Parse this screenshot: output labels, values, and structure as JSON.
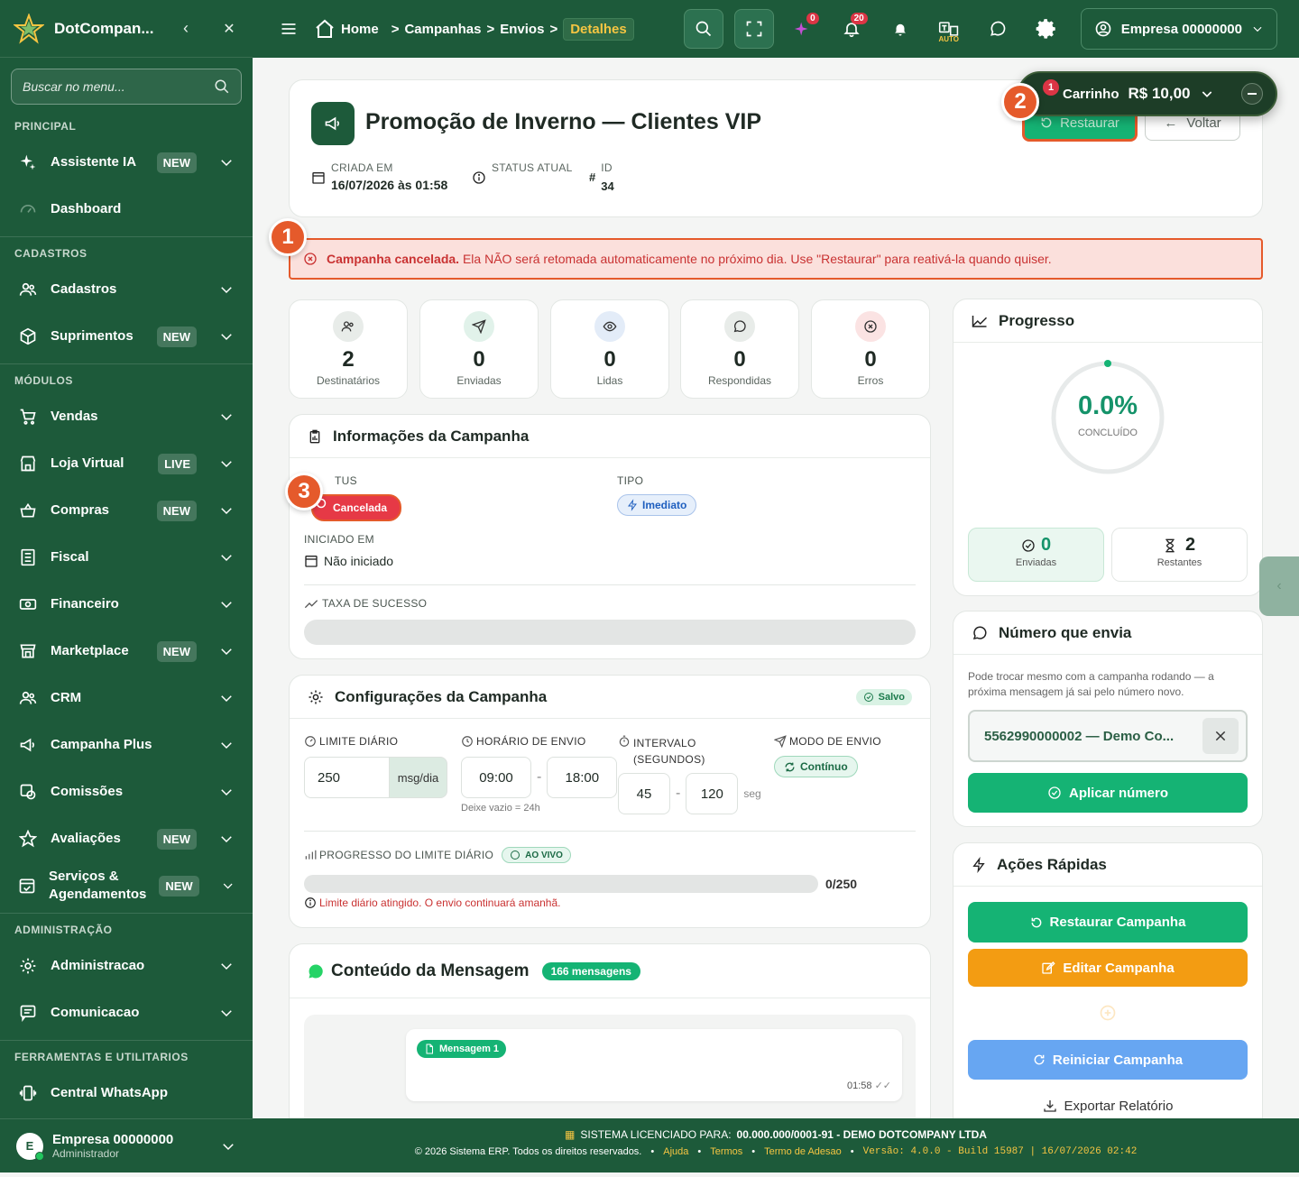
{
  "sidebar": {
    "brand": "DotCompan...",
    "search_placeholder": "Buscar no menu...",
    "sections": {
      "principal": "PRINCIPAL",
      "cadastros": "CADASTROS",
      "modulos": "MÓDULOS",
      "admin": "ADMINISTRAÇÃO",
      "ferramentas": "FERRAMENTAS E UTILITARIOS"
    },
    "items": {
      "assistente": {
        "label": "Assistente IA",
        "badge": "NEW"
      },
      "dashboard": {
        "label": "Dashboard"
      },
      "cadastros": {
        "label": "Cadastros"
      },
      "suprimentos": {
        "label": "Suprimentos",
        "badge": "NEW"
      },
      "vendas": {
        "label": "Vendas"
      },
      "loja": {
        "label": "Loja Virtual",
        "badge": "LIVE"
      },
      "compras": {
        "label": "Compras",
        "badge": "NEW"
      },
      "fiscal": {
        "label": "Fiscal"
      },
      "financeiro": {
        "label": "Financeiro"
      },
      "marketplace": {
        "label": "Marketplace",
        "badge": "NEW"
      },
      "crm": {
        "label": "CRM"
      },
      "campanha": {
        "label": "Campanha Plus"
      },
      "comissoes": {
        "label": "Comissões"
      },
      "avaliacoes": {
        "label": "Avaliações",
        "badge": "NEW"
      },
      "servicos": {
        "label1": "Serviços &",
        "label2": "Agendamentos",
        "badge": "NEW"
      },
      "administracao": {
        "label": "Administracao"
      },
      "comunicacao": {
        "label": "Comunicacao"
      },
      "central": {
        "label": "Central WhatsApp"
      }
    },
    "user": {
      "initial": "E",
      "name": "Empresa 00000000",
      "role": "Administrador"
    }
  },
  "topbar": {
    "crumbs": [
      "Home",
      "Campanhas",
      "Envios"
    ],
    "crumb_active": "Detalhes",
    "ai_badge": "0",
    "notif_badge": "20",
    "auto_label": "AUTO",
    "company": "Empresa 00000000"
  },
  "cart": {
    "label": "Carrinho",
    "count": "1",
    "total": "R$ 10,00"
  },
  "header": {
    "title": "Promoção de Inverno — Clientes VIP",
    "restore_btn": "Restaurar",
    "back_btn": "Voltar",
    "created_label": "CRIADA EM",
    "created_value": "16/07/2026 às 01:58",
    "status_label": "STATUS ATUAL",
    "id_label": "ID",
    "id_value": "34"
  },
  "alert": {
    "strong": "Campanha cancelada.",
    "text": "Ela NÃO será retomada automaticamente no próximo dia. Use \"Restaurar\" para reativá-la quando quiser."
  },
  "steps": [
    "1",
    "2",
    "3"
  ],
  "stats": [
    {
      "value": "2",
      "label": "Destinatários"
    },
    {
      "value": "0",
      "label": "Enviadas"
    },
    {
      "value": "0",
      "label": "Lidas"
    },
    {
      "value": "0",
      "label": "Respondidas"
    },
    {
      "value": "0",
      "label": "Erros"
    }
  ],
  "info": {
    "title": "Informações da Campanha",
    "status_label": "TUS",
    "status_value": "Cancelada",
    "tipo_label": "TIPO",
    "tipo_value": "Imediato",
    "iniciado_label": "INICIADO EM",
    "iniciado_value": "Não iniciado",
    "taxa_label": "TAXA DE SUCESSO"
  },
  "config": {
    "title": "Configurações da Campanha",
    "saved": "Salvo",
    "limite_label": "LIMITE DIÁRIO",
    "limite_value": "250",
    "limite_unit": "msg/dia",
    "horario_label": "HORÁRIO DE ENVIO",
    "horario_start": "09:00",
    "horario_end": "18:00",
    "horario_hint": "Deixe vazio = 24h",
    "intervalo_label1": "INTERVALO",
    "intervalo_label2": "(SEGUNDOS)",
    "intervalo_min": "45",
    "intervalo_max": "120",
    "intervalo_unit": "seg",
    "modo_label": "MODO DE ENVIO",
    "modo_value": "Contínuo",
    "progresso_label": "PROGRESSO DO LIMITE DIÁRIO",
    "ao_vivo": "AO VIVO",
    "progresso_value": "0/250",
    "progresso_fraction": 0,
    "warning": "Limite diário atingido. O envio continuará amanhã."
  },
  "mensagem": {
    "title": "Conteúdo da Mensagem",
    "count": "166 mensagens",
    "msg_label": "Mensagem 1",
    "time": "01:58"
  },
  "progress": {
    "title": "Progresso",
    "percent": "0.0%",
    "fraction": 0,
    "sub": "CONCLUÍDO",
    "sent_value": "0",
    "sent_label": "Enviadas",
    "remain_value": "2",
    "remain_label": "Restantes"
  },
  "numero": {
    "title": "Número que envia",
    "desc": "Pode trocar mesmo com a campanha rodando — a próxima mensagem já sai pelo número novo.",
    "selected": "5562990000002 — Demo Co...",
    "apply_btn": "Aplicar número"
  },
  "acoes": {
    "title": "Ações Rápidas",
    "restaurar": "Restaurar Campanha",
    "editar": "Editar Campanha",
    "reiniciar": "Reiniciar Campanha",
    "exportar": "Exportar Relatório"
  },
  "footer": {
    "license_label": "SISTEMA LICENCIADO PARA:",
    "license_value": "00.000.000/0001-91 - DEMO DOTCOMPANY LTDA",
    "copyright": "© 2026 Sistema ERP. Todos os direitos reservados.",
    "links": [
      "Ajuda",
      "Termos",
      "Termo de Adesao"
    ],
    "version": "Versão: 4.0.0 - Build 15987 | 16/07/2026 02:42"
  },
  "colors": {
    "brand": "#1d5a3a",
    "accent": "#15b374",
    "danger": "#dc3545",
    "orange": "#e55a2b",
    "warning": "#f59e0b",
    "blue": "#5b9cf0"
  }
}
